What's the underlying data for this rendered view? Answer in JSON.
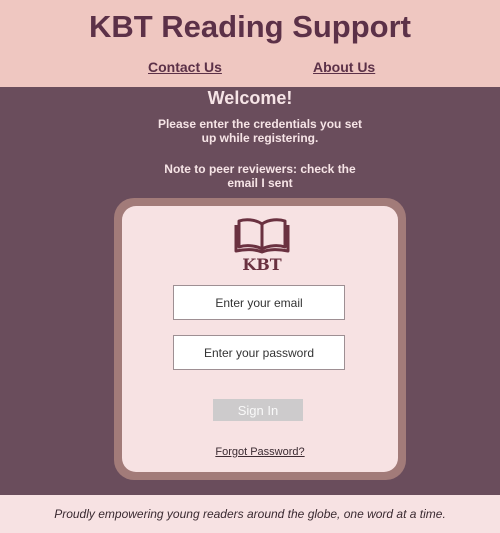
{
  "header": {
    "title": "KBT Reading Support",
    "nav": {
      "contact_label": "Contact Us",
      "about_label": "About Us"
    }
  },
  "main": {
    "welcome": "Welcome!",
    "intro": "Please enter the credentials you set up while registering.",
    "note": "Note to peer reviewers: check the email I sent"
  },
  "login": {
    "logo_icon": "open-book-icon",
    "logo_text": "KBT",
    "email_placeholder": "Enter your email",
    "password_placeholder": "Enter your password",
    "signin_label": "Sign In",
    "forgot_label": "Forgot Password?"
  },
  "footer": {
    "tagline": "Proudly empowering young readers around the globe, one word at a time."
  },
  "colors": {
    "header_bg": "#efc7c1",
    "page_bg": "#6a4d5c",
    "card_border": "#a27b79",
    "card_bg": "#f7e2e3",
    "title_text": "#5c3148",
    "button_disabled": "#cdcbcc"
  }
}
